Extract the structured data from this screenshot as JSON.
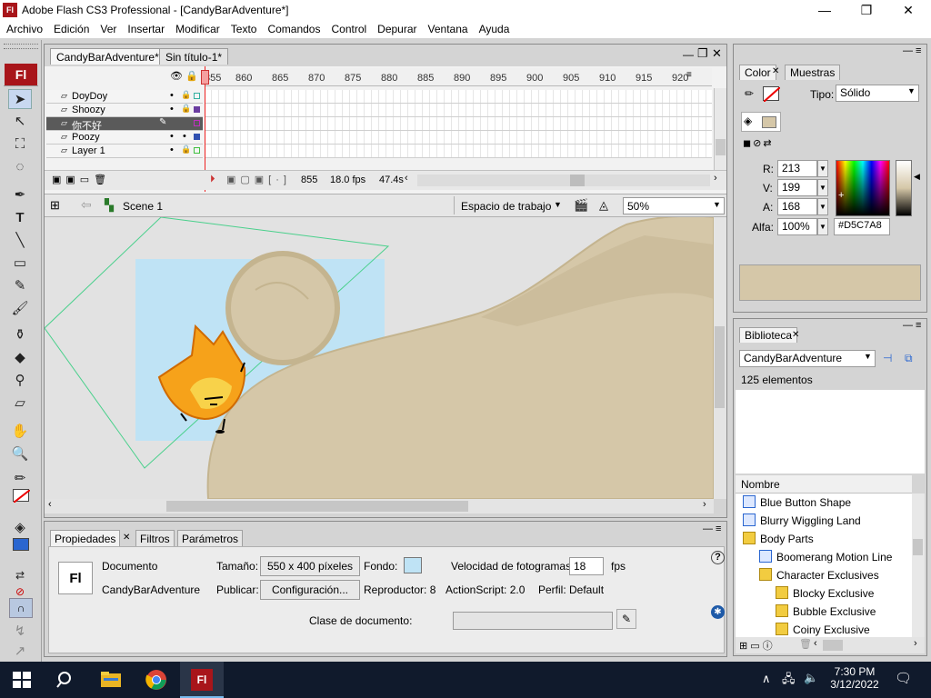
{
  "window": {
    "title": "Adobe Flash CS3 Professional - [CandyBarAdventure*]",
    "app_icon_label": "Fl",
    "minimize": "—",
    "maximize": "❐",
    "close": "✕",
    "brand_color": "#a8151a"
  },
  "menu": [
    "Archivo",
    "Edición",
    "Ver",
    "Insertar",
    "Modificar",
    "Texto",
    "Comandos",
    "Control",
    "Depurar",
    "Ventana",
    "Ayuda"
  ],
  "tools": {
    "logo": "Fl"
  },
  "doc_tabs": [
    "CandyBarAdventure*",
    "Sin título-1*"
  ],
  "timeline": {
    "frame_numbers": [
      "855",
      "860",
      "865",
      "870",
      "875",
      "880",
      "885",
      "890",
      "895",
      "900",
      "905",
      "910",
      "915",
      "920"
    ],
    "layers": [
      {
        "name": "DoyDoy",
        "color": "#34b0a0"
      },
      {
        "name": "Shoozy",
        "color": "#6a3ca0"
      },
      {
        "name": "你不好",
        "color": "#c030c0"
      },
      {
        "name": "Poozy",
        "color": "#3050b0"
      },
      {
        "name": "Layer 1",
        "color": "#40c040"
      }
    ],
    "current_frame": "855",
    "fps": "18.0 fps",
    "time": "47.4s"
  },
  "edit_bar": {
    "scene": "Scene 1",
    "workspace": "Espacio de trabajo",
    "zoom": "50%"
  },
  "stage_colors": {
    "pasteboard": "#e2e2e2",
    "stage": "#bfe3f5",
    "sand": "#d5c7a8",
    "sand_shadow": "#c4b48f"
  },
  "properties": {
    "tabs": [
      "Propiedades",
      "Filtros",
      "Parámetros"
    ],
    "doc_label": "Documento",
    "doc_name": "CandyBarAdventure",
    "icon_label": "Fl",
    "size_label": "Tamaño:",
    "size_value": "550 x 400 píxeles",
    "bg_label": "Fondo:",
    "fps_label": "Velocidad de fotogramas:",
    "fps_value": "18",
    "fps_unit": "fps",
    "publish_label": "Publicar:",
    "publish_button": "Configuración...",
    "player": "Reproductor: 8",
    "actionscript": "ActionScript: 2.0",
    "profile": "Perfil: Default",
    "class_label": "Clase de documento:",
    "class_value": ""
  },
  "color_panel": {
    "tabs": [
      "Color",
      "Muestras"
    ],
    "type_label": "Tipo:",
    "type_value": "Sólido",
    "r_label": "R:",
    "r_value": "213",
    "g_label": "V:",
    "g_value": "199",
    "b_label": "A:",
    "b_value": "168",
    "alpha_label": "Alfa:",
    "alpha_value": "100%",
    "hex": "#D5C7A8",
    "swatch": "#d5c7a8"
  },
  "library": {
    "tab": "Biblioteca",
    "doc_select": "CandyBarAdventure",
    "count": "125 elementos",
    "col_header": "Nombre",
    "items": [
      {
        "name": "Blue Button Shape",
        "type": "symbol",
        "indent": 0
      },
      {
        "name": "Blurry Wiggling Land",
        "type": "symbol",
        "indent": 0
      },
      {
        "name": "Body Parts",
        "type": "folder-open",
        "indent": 0
      },
      {
        "name": "Boomerang Motion Line",
        "type": "symbol",
        "indent": 1
      },
      {
        "name": "Character Exclusives",
        "type": "folder-open",
        "indent": 1
      },
      {
        "name": "Blocky Exclusive",
        "type": "folder",
        "indent": 2
      },
      {
        "name": "Bubble Exclusive",
        "type": "folder",
        "indent": 2
      },
      {
        "name": "Coiny Exclusive",
        "type": "folder",
        "indent": 2
      }
    ]
  },
  "taskbar": {
    "time": "7:30 PM",
    "date": "3/12/2022",
    "flash_label": "Fl"
  }
}
